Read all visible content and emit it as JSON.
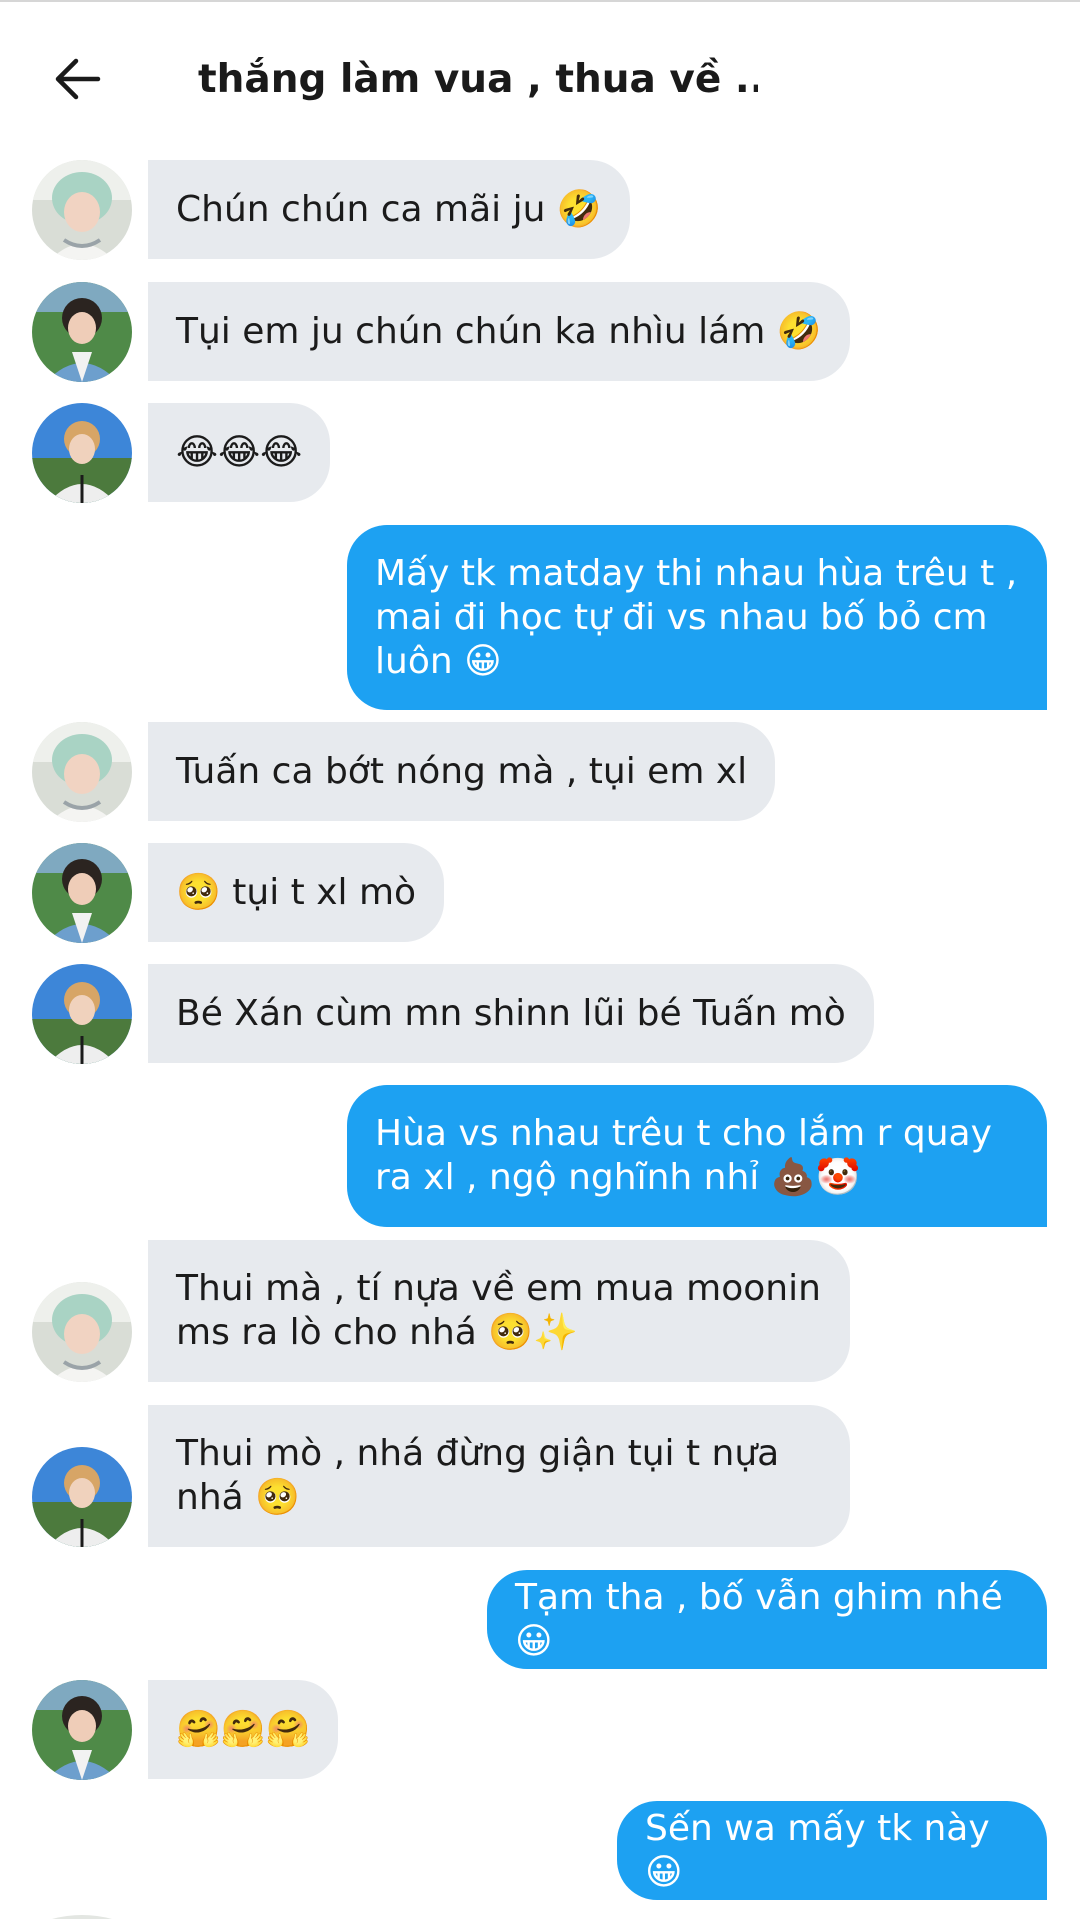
{
  "header": {
    "title": "thắng làm vua , thua về ...",
    "back_icon": "arrow-left-icon"
  },
  "colors": {
    "incoming_bubble": "#e7eaee",
    "outgoing_bubble": "#1da1f2",
    "outgoing_text": "#ffffff",
    "incoming_text": "#1b1b1b"
  },
  "messages": [
    {
      "side": "incoming",
      "sender_avatar": "avatar-mint-hair",
      "text": "Chún chún ca mãi ju 🤣"
    },
    {
      "side": "incoming",
      "sender_avatar": "avatar-denim-jacket",
      "text": "Tụi em ju chún chún ka nhìu lám 🤣"
    },
    {
      "side": "incoming",
      "sender_avatar": "avatar-blue-sky",
      "text": "😂😂😂"
    },
    {
      "side": "outgoing",
      "text": "Mấy tk matday thi nhau hùa trêu t , mai đi học tự đi vs nhau bố bỏ cm luôn 😀"
    },
    {
      "side": "incoming",
      "sender_avatar": "avatar-mint-hair",
      "text": "Tuấn ca bớt nóng mà , tụi em xl"
    },
    {
      "side": "incoming",
      "sender_avatar": "avatar-denim-jacket",
      "text": "🥺 tụi t xl mò"
    },
    {
      "side": "incoming",
      "sender_avatar": "avatar-blue-sky",
      "text": "Bé Xán cùm mn shinn lũi bé Tuấn mò"
    },
    {
      "side": "outgoing",
      "text": "Hùa vs nhau trêu t cho lắm r quay ra xl , ngộ nghĩnh nhỉ 💩🤡"
    },
    {
      "side": "incoming",
      "sender_avatar": "avatar-mint-hair",
      "text": "Thui mà , tí nựa về em mua moonin ms ra lò cho nhá 🥺✨"
    },
    {
      "side": "incoming",
      "sender_avatar": "avatar-blue-sky",
      "text": "Thui mò , nhá đừng giận tụi t nựa nhá 🥺"
    },
    {
      "side": "outgoing",
      "text": "Tạm tha , bố vẫn ghim nhé 😀"
    },
    {
      "side": "incoming",
      "sender_avatar": "avatar-denim-jacket",
      "text": "🤗🤗🤗"
    },
    {
      "side": "outgoing",
      "text": "Sến wa mấy tk này 😀"
    }
  ]
}
